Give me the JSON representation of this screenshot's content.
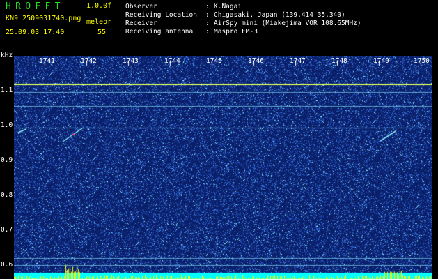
{
  "header": {
    "app_title": "HROFFT",
    "version": "1.0.0f",
    "filename": "KN9_2509031740.png",
    "timestamp": "25.09.03 17:40",
    "mode": "meleor",
    "count": "55"
  },
  "info": [
    {
      "label": "Observer",
      "value": "K.Nagai"
    },
    {
      "label": "Receiving Location",
      "value": "Chigasaki, Japan (139.414 35.340)"
    },
    {
      "label": "Receiver",
      "value": "AirSpy mini (Miakejima VOR 108.65MHz)"
    },
    {
      "label": "Receiving antenna",
      "value": "Maspro FM-3"
    }
  ],
  "axis": {
    "unit": "kHz",
    "y_ticks": [
      "1.1",
      "1.0",
      "0.9",
      "0.8",
      "0.7",
      "0.6"
    ],
    "x_ticks": [
      "1741",
      "1742",
      "1743",
      "1744",
      "1745",
      "1746",
      "1747",
      "1748",
      "1749",
      "1750"
    ]
  },
  "colors": {
    "background": "#0a1f6a",
    "noise": "#3a78d8",
    "bright": "#8cf0ff",
    "carrier": "#e0ff60",
    "baseline": "#00ffff",
    "spike": "#ffff00"
  }
}
